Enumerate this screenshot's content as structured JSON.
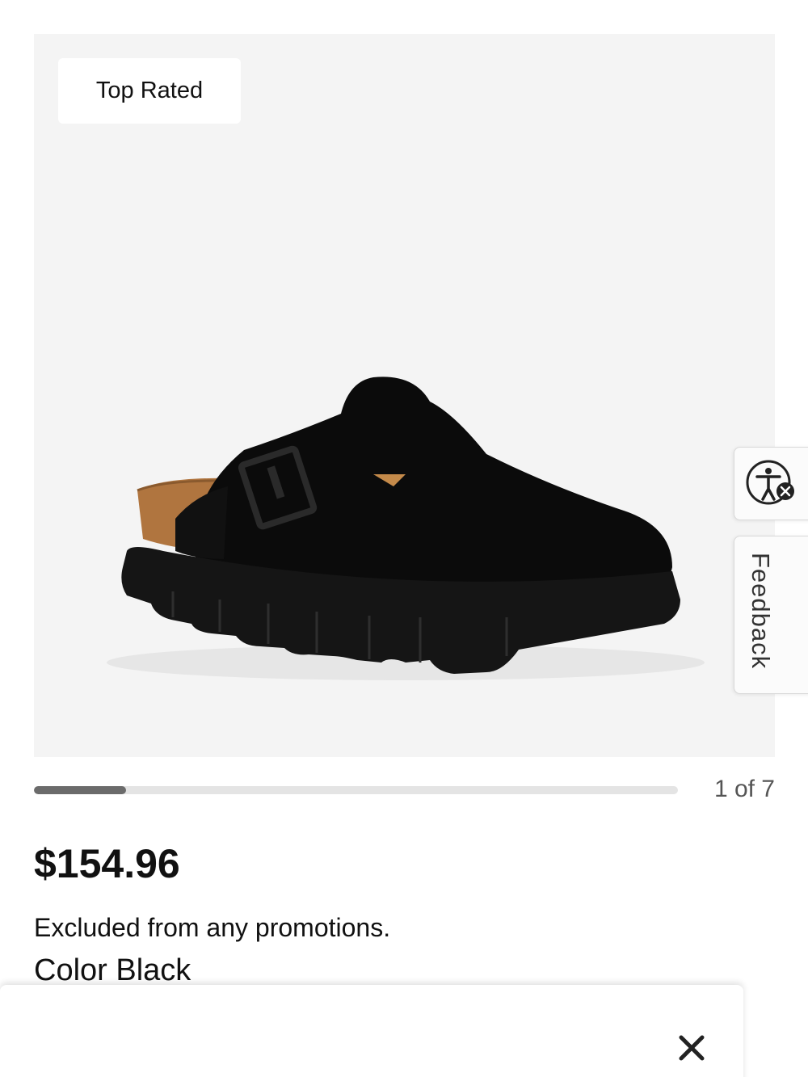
{
  "product": {
    "badge": "Top Rated",
    "image_alt": "Black suede platform clog",
    "price": "$154.96",
    "promo_note": "Excluded from any promotions.",
    "color_label": "Color",
    "color_value": "Black"
  },
  "gallery": {
    "counter": "1 of 7",
    "progress_fraction": 0.143
  },
  "side_tabs": {
    "accessibility_icon": "accessibility-icon",
    "feedback_label": "Feedback"
  },
  "bottom_sheet": {
    "close_icon": "close-icon"
  },
  "colors": {
    "panel_bg": "#f4f4f4",
    "progress_fill": "#6b6b6b",
    "progress_track": "#e4e4e4",
    "text": "#111111"
  }
}
